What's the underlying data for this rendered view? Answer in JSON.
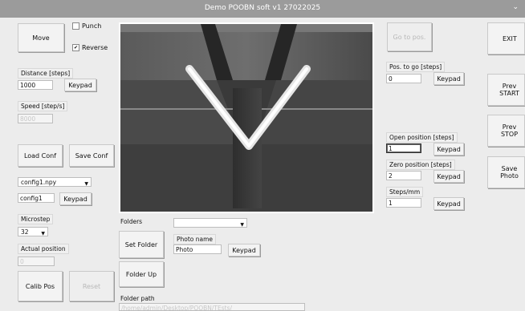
{
  "window": {
    "title": "Demo POOBN soft v1 27022025",
    "chevron_icon": "chevron-down-icon"
  },
  "left": {
    "move_label": "Move",
    "punch_label": "Punch",
    "punch_checked": false,
    "reverse_label": "Reverse",
    "reverse_checked": true,
    "distance_label": "Distance [steps]",
    "distance_value": "1000",
    "speed_label": "Speed [step/s]",
    "speed_value": "8000",
    "keypad_label": "Keypad",
    "load_conf_label": "Load Conf",
    "save_conf_label": "Save Conf",
    "config_select": "config1.npy",
    "config_name": "config1",
    "microstep_label": "Microstep",
    "microstep_value": "32",
    "actual_position_label": "Actual position",
    "actual_position_value": "0",
    "calib_pos_label": "Calib Pos",
    "reset_label": "Reset"
  },
  "folders": {
    "folders_label": "Folders",
    "folders_select": "",
    "set_folder_label": "Set Folder",
    "photo_name_label": "Photo name",
    "photo_name_value": "Photo",
    "keypad_label": "Keypad",
    "folder_up_label": "Folder Up",
    "folder_path_label": "Folder path",
    "folder_path_value": "/home/admin/Desktop/POOBN/TEsts/"
  },
  "right": {
    "go_to_pos_label": "Go to pos.",
    "pos_to_go_label": "Pos. to go [steps]",
    "pos_to_go_value": "0",
    "open_position_label": "Open position [steps]",
    "open_position_value": "1",
    "zero_position_label": "Zero position [steps]",
    "zero_position_value": "2",
    "steps_mm_label": "Steps/mm",
    "steps_mm_value": "1",
    "keypad_label": "Keypad"
  },
  "far_right": {
    "exit_label": "EXIT",
    "prev_start_label": "Prev START",
    "prev_stop_label": "Prev STOP",
    "save_photo_label": "Save Photo"
  }
}
